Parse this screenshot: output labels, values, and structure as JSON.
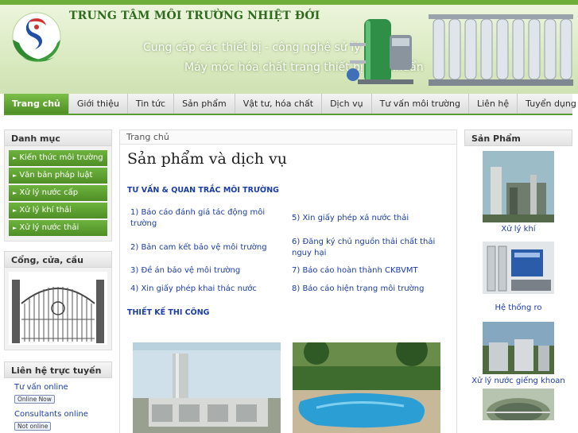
{
  "header": {
    "site_title": "TRUNG TÂM MÔI TRƯỜNG NHIỆT ĐỚI",
    "slogan_line1": "Cung cấp các thiết bị - công nghệ sử lý",
    "slogan_line2": "Máy móc hóa chất trang thiết bị tiệt khuẩn"
  },
  "nav": {
    "items": [
      "Trang chủ",
      "Giới thiệu",
      "Tin tức",
      "Sản phẩm",
      "Vật tư, hóa chất",
      "Dịch vụ",
      "Tư vấn môi trường",
      "Liên hệ",
      "Tuyển dụng"
    ],
    "active": "Trang chủ"
  },
  "left": {
    "category_title": "Danh mục",
    "categories": [
      "Kiến thức môi trường",
      "Văn bản pháp luật",
      "Xử lý nước cấp",
      "Xử lý khí thải",
      "Xử lý nước thải"
    ],
    "gate_title": "Cổng, cửa, cầu thang",
    "contact_title": "Liên hệ trực tuyến",
    "contacts": [
      {
        "label": "Tư vấn online",
        "status": "Online Now"
      },
      {
        "label": "Consultants online",
        "status": "Not online"
      }
    ]
  },
  "main": {
    "breadcrumb": "Trang chủ",
    "title": "Sản phẩm và dịch vụ",
    "section1": "TƯ VẤN & QUAN TRẮC MÔI TRƯỜNG",
    "services_left": [
      "1) Báo cáo đánh giá tác động môi trường",
      "2) Bản cam kết bảo vệ môi trường",
      "3) Đề án bảo vệ môi trường",
      "4) Xin giấy phép khai thác nước"
    ],
    "services_right": [
      "5) Xin giấy phép xả nước thải",
      "6) Đăng ký chủ nguồn thải chất thải nguy hại",
      "7) Báo cáo hoàn thành CKBVMT",
      "8) Báo cáo hiện trạng môi trường"
    ],
    "section2": "THIẾT KẾ THI CÔNG"
  },
  "right": {
    "title": "Sản Phẩm",
    "products": [
      "Xử lý khí",
      "Hệ thống ro",
      "Xử lý nước giếng khoan"
    ]
  },
  "colors": {
    "brand_green": "#5d9b2e",
    "link_blue": "#1a3da8"
  }
}
